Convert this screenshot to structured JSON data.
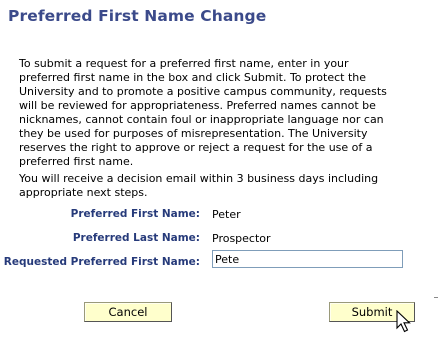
{
  "page": {
    "title": "Preferred First Name Change"
  },
  "intro": {
    "paragraph1": "To submit a request for a preferred first name, enter in your preferred first name in the box and click Submit. To protect the University and to promote a positive campus community, requests will be reviewed for appropriateness. Preferred names cannot be nicknames, cannot contain foul or inappropriate language nor can they be used for purposes of misrepresentation. The University reserves the right to approve or reject a request for the use of a preferred first name.",
    "paragraph2": "You will receive a decision email within 3 business days including appropriate next steps."
  },
  "fields": {
    "preferred_first": {
      "label": "Preferred First Name:",
      "value": "Peter"
    },
    "preferred_last": {
      "label": "Preferred Last Name:",
      "value": "Prospector"
    },
    "requested_first": {
      "label": "Requested Preferred First Name:",
      "value": "Pete"
    }
  },
  "buttons": {
    "cancel": "Cancel",
    "submit": "Submit"
  },
  "icons": {
    "cursor": "arrow-pointer-icon"
  },
  "colors": {
    "title": "#3b4a8a",
    "label": "#263a7a",
    "button_bg": "#ffffcc"
  }
}
